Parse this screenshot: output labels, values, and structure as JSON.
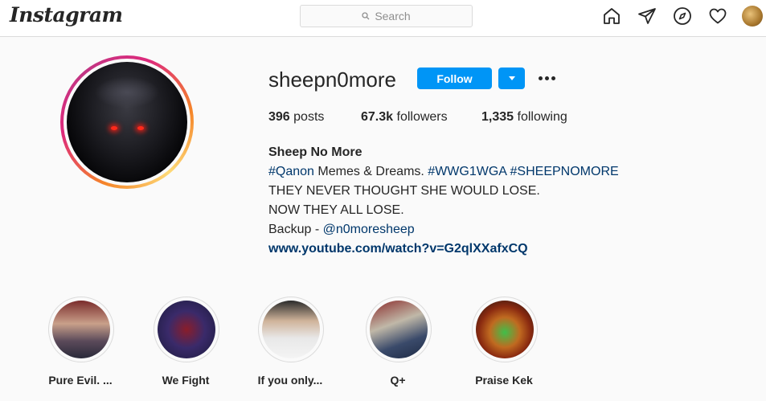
{
  "navbar": {
    "logo": "Instagram",
    "search_placeholder": "Search",
    "icons": [
      "home-icon",
      "direct-icon",
      "explore-icon",
      "activity-heart-icon",
      "profile-avatar"
    ]
  },
  "profile": {
    "username": "sheepn0more",
    "follow_label": "Follow",
    "stats": {
      "posts_count": "396",
      "posts_label": " posts",
      "followers_count": "67.3k",
      "followers_label": " followers",
      "following_count": "1,335",
      "following_label": " following"
    },
    "bio": {
      "name": "Sheep No More",
      "line1_tag1": "#Qanon",
      "line1_text": " Memes & Dreams. ",
      "line1_tag2": "#WWG1WGA",
      "line1_space": " ",
      "line1_tag3": "#SHEEPNOMORE",
      "line2": "THEY NEVER THOUGHT SHE WOULD LOSE.",
      "line3": "NOW THEY ALL LOSE.",
      "line4_text": "Backup - ",
      "line4_mention": "@n0moresheep",
      "website": "www.youtube.com/watch?v=G2qlXXafxCQ"
    }
  },
  "highlights": [
    {
      "label": "Pure Evil. ..."
    },
    {
      "label": "We Fight"
    },
    {
      "label": "If you only..."
    },
    {
      "label": "Q+"
    },
    {
      "label": "Praise Kek"
    }
  ],
  "colors": {
    "accent": "#0095f6",
    "link": "#00376b",
    "text": "#262626",
    "background": "#fafafa"
  }
}
